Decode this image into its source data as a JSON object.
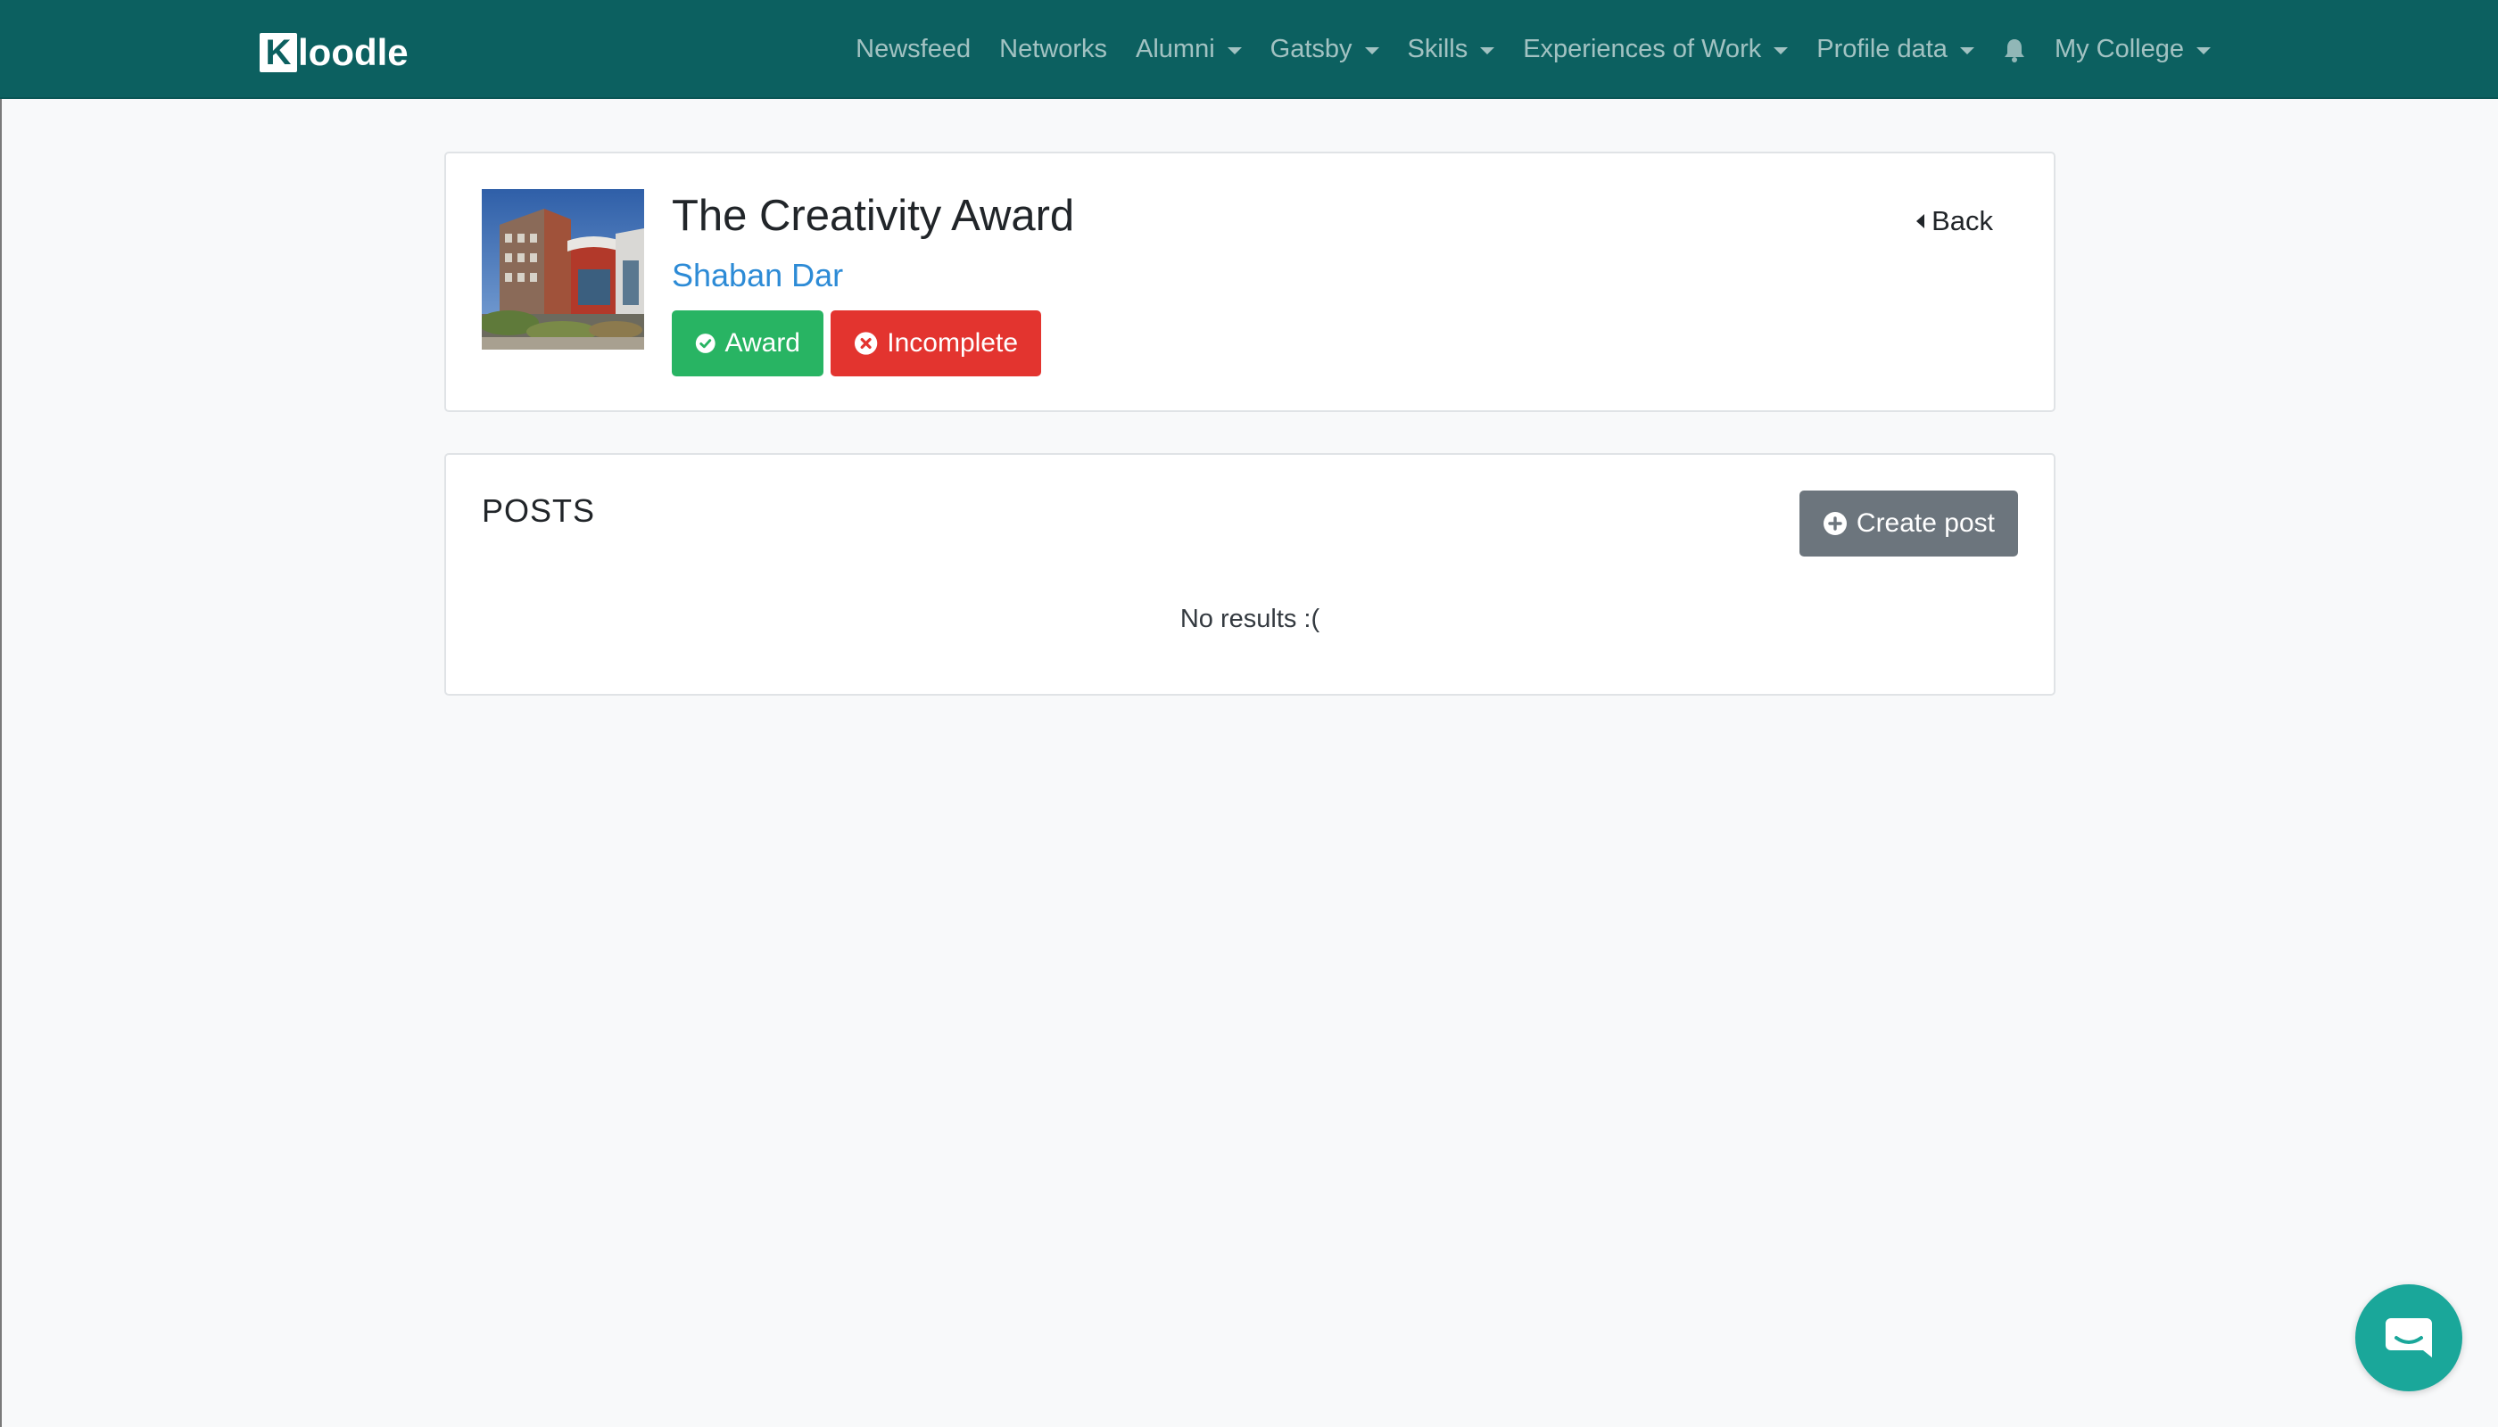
{
  "brand": {
    "box_letter": "K",
    "rest": "loodle",
    "color": "#0c6060"
  },
  "navbar": {
    "items": [
      {
        "label": "Newsfeed",
        "dropdown": false
      },
      {
        "label": "Networks",
        "dropdown": false
      },
      {
        "label": "Alumni",
        "dropdown": true
      },
      {
        "label": "Gatsby",
        "dropdown": true
      },
      {
        "label": "Skills",
        "dropdown": true
      },
      {
        "label": "Experiences of Work",
        "dropdown": true
      },
      {
        "label": "Profile data",
        "dropdown": true
      },
      {
        "label": "My College",
        "dropdown": true
      }
    ],
    "notification_icon": "bell-icon"
  },
  "award": {
    "title": "The Creativity Award",
    "owner": "Shaban Dar",
    "image_icon": "building-photo",
    "type_label": "Award",
    "status_label": "Incomplete",
    "back_label": "Back",
    "type_color": "#28b463",
    "status_color": "#e3342f"
  },
  "posts": {
    "title": "POSTS",
    "create_label": "Create post",
    "empty_text": "No results :("
  },
  "chat": {
    "icon": "chat-icon",
    "color": "#1aa79a"
  }
}
